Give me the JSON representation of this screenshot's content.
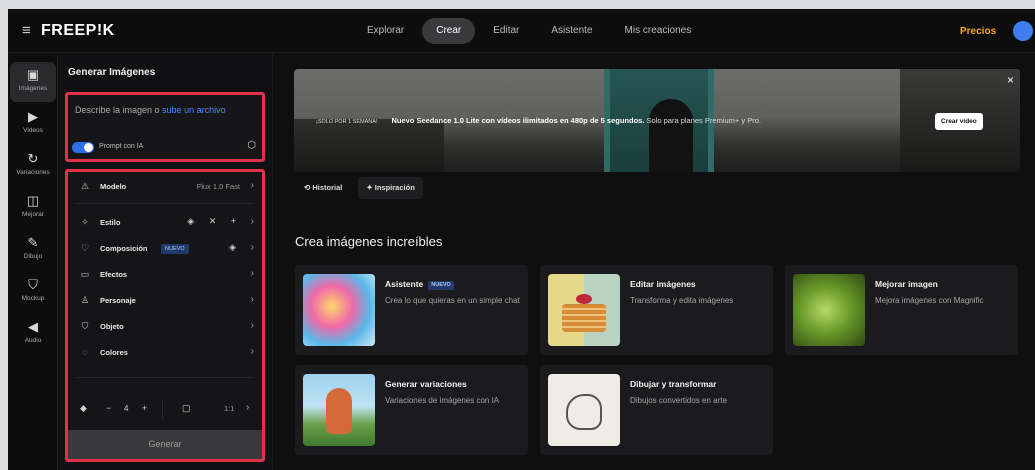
{
  "topbar": {
    "logo": "FREEP!K",
    "nav": [
      "Explorar",
      "Crear",
      "Editar",
      "Asistente",
      "Mis creaciones"
    ],
    "active_nav": "Crear",
    "pricing_label": "Precios"
  },
  "rail": [
    {
      "label": "Imágenes",
      "icon": "image-icon"
    },
    {
      "label": "Videos",
      "icon": "video-icon"
    },
    {
      "label": "Variaciones",
      "icon": "refresh-icon"
    },
    {
      "label": "Mejorar",
      "icon": "enhance-icon"
    },
    {
      "label": "Dibujo",
      "icon": "pen-icon"
    },
    {
      "label": "Mockup",
      "icon": "shirt-icon"
    },
    {
      "label": "Audio",
      "icon": "audio-icon"
    }
  ],
  "panel": {
    "title": "Generar Imágenes",
    "prompt_text": "Describe la imagen o ",
    "prompt_link": "sube un archivo",
    "toggle_label": "Prompt con IA",
    "model_label": "Modelo",
    "model_value": "Flux 1.0 Fast",
    "options": {
      "estilo": "Estilo",
      "composicion": "Composición",
      "composicion_badge": "NUEVO",
      "efectos": "Efectos",
      "personaje": "Personaje",
      "objeto": "Objeto",
      "colores": "Colores"
    },
    "count_minus": "−",
    "count_value": "4",
    "count_plus": "+",
    "ratio_value": "1:1",
    "generate_label": "Generar"
  },
  "banner": {
    "tag": "¡SOLO POR 1 SEMANA!",
    "headline": "Nuevo Seedance 1.0 Lite con vídeos ilimitados en 480p de 5 segundos.",
    "rest": " Solo para planes Premium+ y Pro.",
    "cta": "Crear vídeo",
    "close": "×"
  },
  "subtabs": [
    "Historial",
    "Inspiración"
  ],
  "section_title": "Crea imágenes increíbles",
  "cards": [
    {
      "title": "Asistente",
      "badge": "NUEVO",
      "desc": "Crea lo que quieras en un simple chat"
    },
    {
      "title": "Editar imágenes",
      "desc": "Transforma y edita imágenes"
    },
    {
      "title": "Mejorar imagen",
      "desc": "Mejora imágenes con Magnific"
    },
    {
      "title": "Generar variaciones",
      "desc": "Variaciones de imágenes con IA"
    },
    {
      "title": "Dibujar y transformar",
      "desc": "Dibujos convertidos en arte"
    }
  ],
  "colors": {
    "accent": "#2f6fe8",
    "highlight_border": "#e0324b",
    "pricing": "#f5a623"
  }
}
